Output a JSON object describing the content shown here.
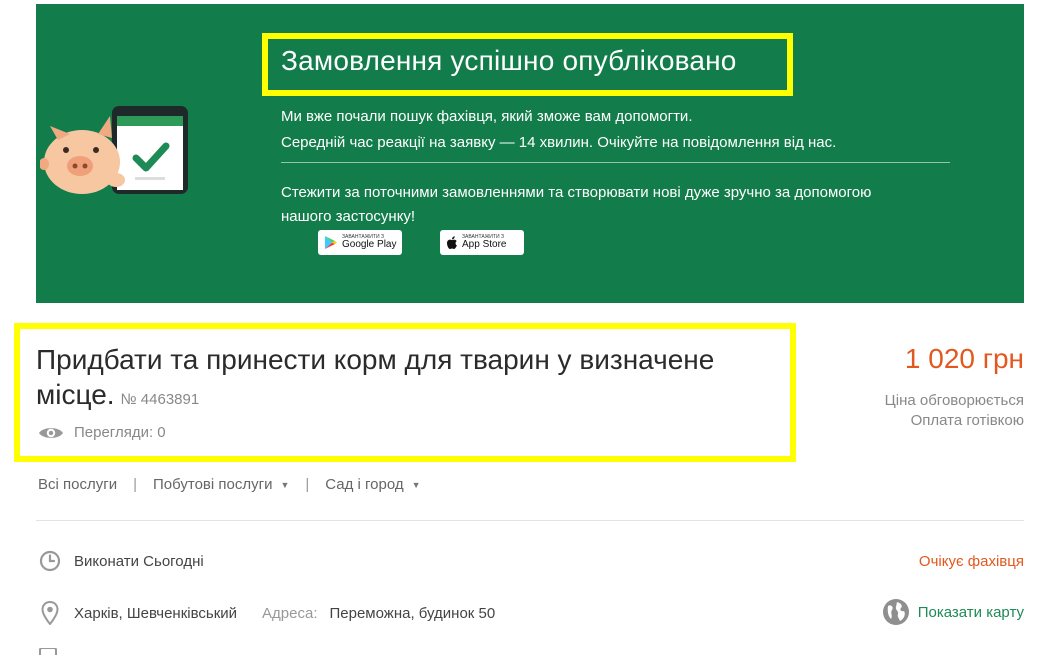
{
  "banner": {
    "title": "Замовлення успішно опубліковано",
    "line1": "Ми вже почали пошук фахівця, який зможе вам допомогти.",
    "line2": "Середній час реакції на заявку — 14 хвилин. Очікуйте на повідомлення від нас.",
    "line3": "Стежити за поточними замовленнями та створювати нові дуже зручно за допомогою",
    "line4": "нашого застосунку!",
    "google_play": {
      "small": "ЗАВАНТАЖИТИ З",
      "big": "Google Play"
    },
    "app_store": {
      "small": "ЗАВАНТАЖИТИ З",
      "big": "App Store"
    },
    "colors": {
      "background": "#127d4b",
      "highlight": "#ffff00"
    }
  },
  "order": {
    "title_line1": "Придбати та принести корм для тварин у визначене",
    "title_line2": "місце.",
    "number": "№ 4463891",
    "views": "Перегляди: 0",
    "price": "1 020 грн",
    "price_note1": "Ціна обговорюється",
    "price_note2": "Оплата готівкою",
    "price_color": "#e2581e"
  },
  "breadcrumbs": {
    "all": "Всі послуги",
    "category": "Побутові послуги",
    "subcategory": "Сад і город"
  },
  "details": {
    "when": "Виконати Сьогодні",
    "status": "Очікує фахівця",
    "city": "Харків, Шевченківський",
    "address_label": "Адреса:",
    "address": "Переможна, будинок 50",
    "show_map": "Показати карту",
    "link_color": "#1e8a55"
  }
}
